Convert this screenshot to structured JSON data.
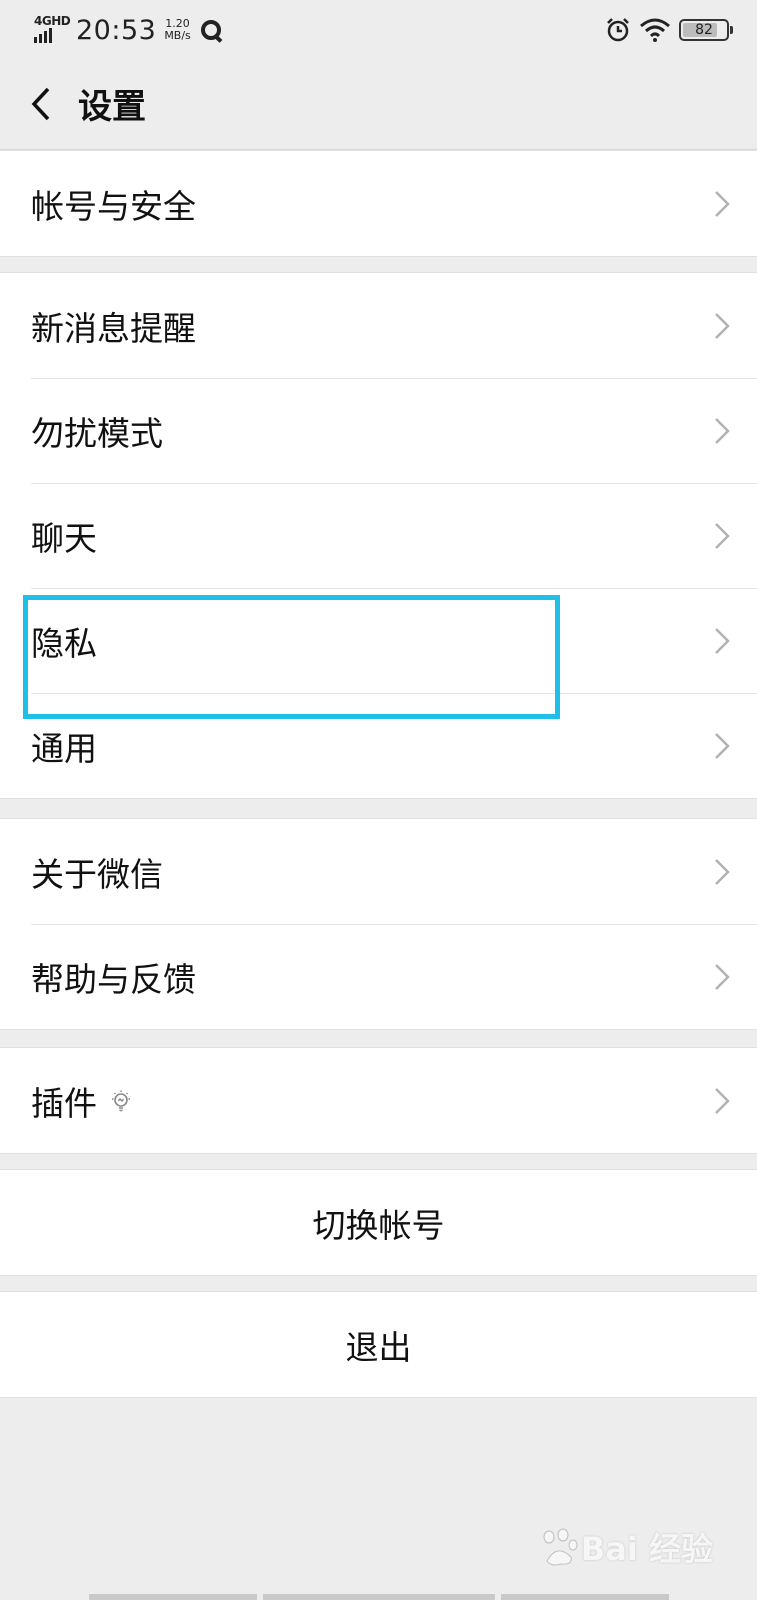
{
  "status_bar": {
    "network": "4GHD",
    "time": "20:53",
    "speed_value": "1.20",
    "speed_unit": "MB/s",
    "battery": "82",
    "battery_level": 0.82
  },
  "header": {
    "title": "设置"
  },
  "groups": [
    {
      "items": [
        {
          "label": "帐号与安全"
        }
      ]
    },
    {
      "items": [
        {
          "label": "新消息提醒"
        },
        {
          "label": "勿扰模式"
        },
        {
          "label": "聊天"
        },
        {
          "label": "隐私"
        },
        {
          "label": "通用"
        }
      ]
    },
    {
      "items": [
        {
          "label": "关于微信"
        },
        {
          "label": "帮助与反馈"
        }
      ]
    },
    {
      "items": [
        {
          "label": "插件"
        }
      ]
    }
  ],
  "actions": {
    "switch_account": "切换帐号",
    "logout": "退出"
  },
  "watermark": {
    "text": "Bai 经验",
    "url": "jingyan.baidu.com"
  },
  "colors": {
    "background": "#ededed",
    "highlight": "#1ec0e7"
  }
}
